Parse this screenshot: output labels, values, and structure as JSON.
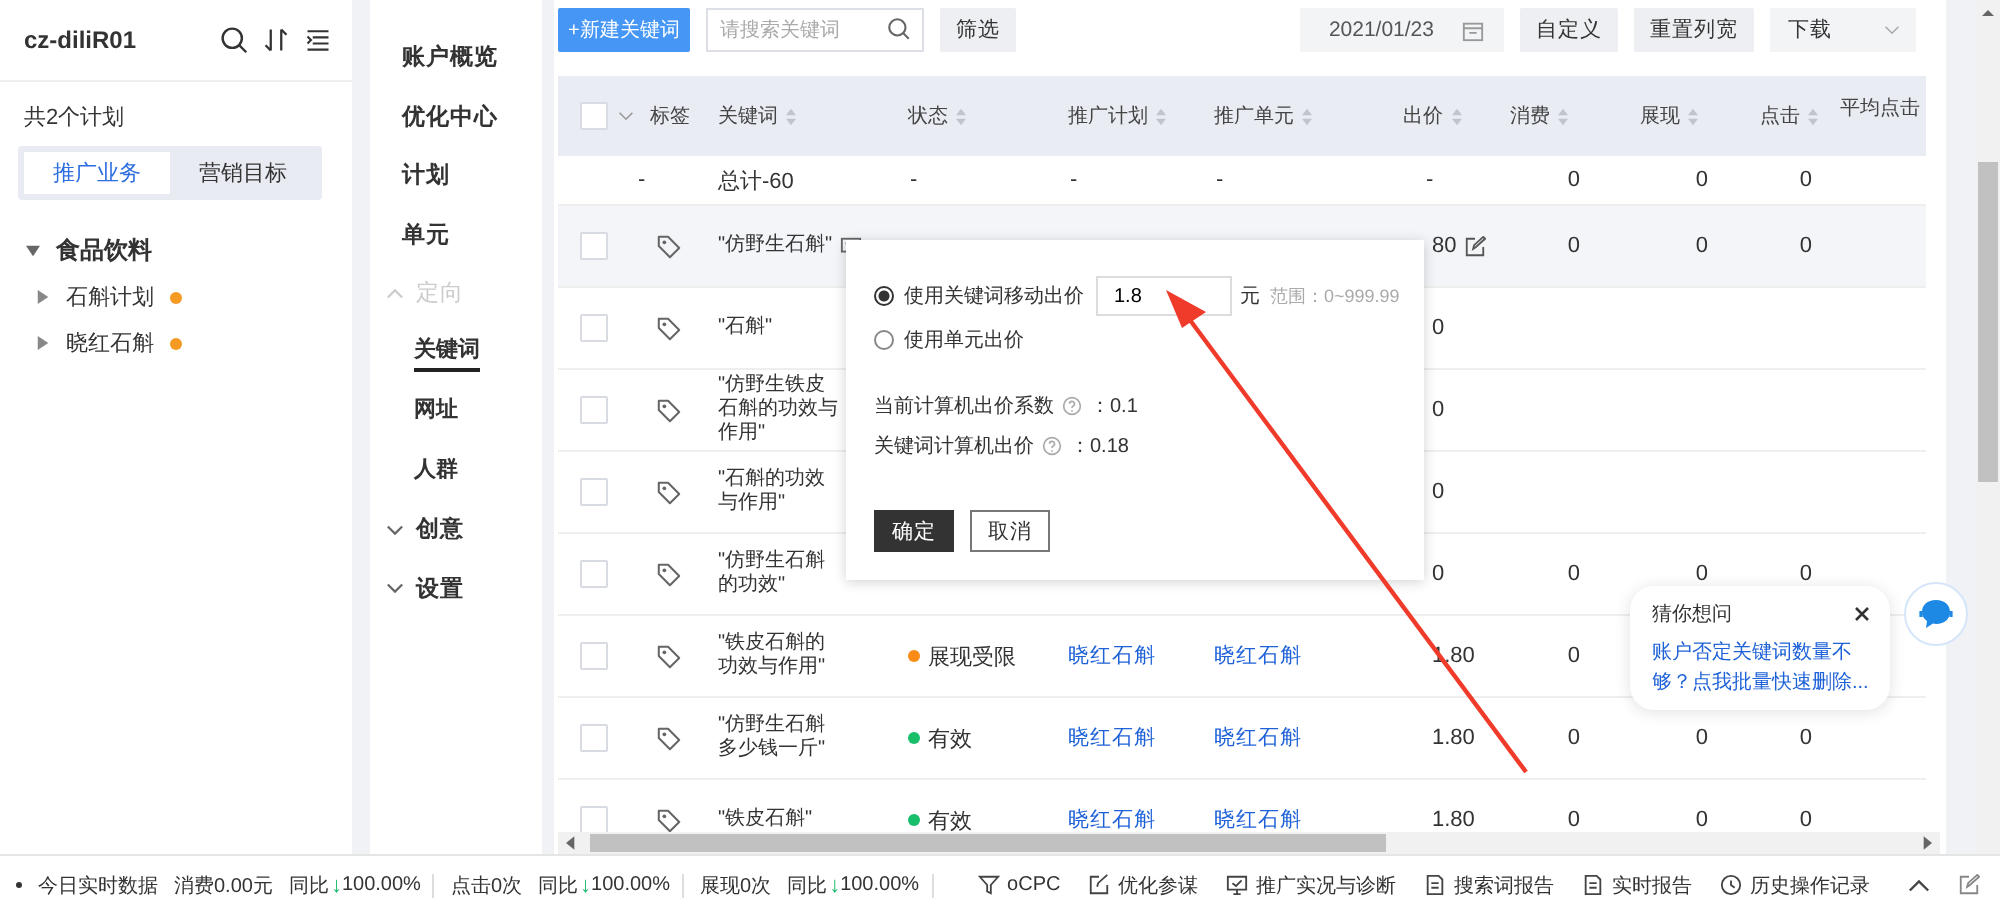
{
  "account": {
    "name": "cz-diliR01",
    "plan_count": "共2个计划"
  },
  "tabs": [
    {
      "label": "推广业务",
      "selected": true
    },
    {
      "label": "营销目标",
      "selected": false
    }
  ],
  "tree": [
    {
      "label": "食品饮料",
      "expanded": true,
      "children": [
        {
          "label": "石斛计划",
          "expanded": false,
          "color": "#f59a23"
        },
        {
          "label": "晓红石斛",
          "expanded": false,
          "color": "#f59a23"
        }
      ]
    }
  ],
  "nav": [
    {
      "label": "账户概览",
      "kind": "link",
      "selected": false
    },
    {
      "label": "优化中心",
      "kind": "link",
      "selected": false
    },
    {
      "label": "计划",
      "kind": "link",
      "selected": false
    },
    {
      "label": "单元",
      "kind": "link",
      "selected": false
    },
    {
      "label": "定向",
      "kind": "group",
      "expanded": true,
      "children": [
        {
          "label": "关键词",
          "selected": true
        },
        {
          "label": "网址",
          "selected": false
        },
        {
          "label": "人群",
          "selected": false
        }
      ]
    },
    {
      "label": "创意",
      "kind": "group",
      "expanded": false
    },
    {
      "label": "设置",
      "kind": "group",
      "expanded": false
    }
  ],
  "toolbar": {
    "new_button": "+新建关键词",
    "search": {
      "placeholder": "请搜索关键词"
    },
    "filter_button": "筛选",
    "date": "2021/01/23",
    "buttons": [
      "自定义",
      "重置列宽"
    ],
    "download": "下载"
  },
  "table": {
    "header_checkbox": {
      "checked": false
    },
    "columns": [
      {
        "label": "标签",
        "sortable": false
      },
      {
        "label": "关键词",
        "sortable": true
      },
      {
        "label": "状态",
        "sortable": true
      },
      {
        "label": "推广计划",
        "sortable": true
      },
      {
        "label": "推广单元",
        "sortable": true
      },
      {
        "label": "出价",
        "sortable": true
      },
      {
        "label": "消费",
        "sortable": true
      },
      {
        "label": "展现",
        "sortable": true
      },
      {
        "label": "点击",
        "sortable": true
      },
      {
        "label": "平均点击",
        "sortable": false
      }
    ],
    "total_row": [
      "-",
      "总计-60",
      "-",
      "-",
      "-",
      "-",
      "0",
      "0",
      "0"
    ],
    "rows": [
      {
        "selected": false,
        "keyword": "\"仿野生石斛\"",
        "note_icon": true,
        "price": "80",
        "edit_icon": true,
        "cost": "0",
        "impressions": "0",
        "clicks": "0"
      },
      {
        "selected": false,
        "keyword": "\"石斛\"",
        "note_icon": false,
        "price": "0",
        "edit_icon": false
      },
      {
        "selected": false,
        "keyword": "\"仿野生铁皮石斛的功效与作用\"",
        "note_icon": false,
        "price": "0",
        "edit_icon": false
      },
      {
        "selected": false,
        "keyword": "\"石斛的功效与作用\"",
        "note_icon": false,
        "price": "0",
        "edit_icon": false
      },
      {
        "selected": false,
        "keyword": "\"仿野生石斛的功效\"",
        "note_icon": false,
        "price": "0",
        "edit_icon": false,
        "cost": "0",
        "impressions": "0",
        "clicks": "0"
      },
      {
        "selected": false,
        "keyword": "\"铁皮石斛的功效与作用\"",
        "note_icon": false,
        "status": {
          "label": "展现受限",
          "color": "#fa8c16"
        },
        "plan": "晓红石斛",
        "unit": "晓红石斛",
        "price": "1.80",
        "edit_icon": false,
        "cost": "0"
      },
      {
        "selected": false,
        "keyword": "\"仿野生石斛多少钱一斤\"",
        "note_icon": false,
        "status": {
          "label": "有效",
          "color": "#19be6b"
        },
        "plan": "晓红石斛",
        "unit": "晓红石斛",
        "price": "1.80",
        "edit_icon": false,
        "cost": "0",
        "impressions": "0",
        "clicks": "0"
      },
      {
        "selected": false,
        "keyword": "\"铁皮石斛\"",
        "note_icon": false,
        "status": {
          "label": "有效",
          "color": "#19be6b"
        },
        "plan": "晓红石斛",
        "unit": "晓红石斛",
        "price": "1.80",
        "edit_icon": false,
        "cost": "0",
        "impressions": "0",
        "clicks": "0"
      }
    ]
  },
  "popover": {
    "options": [
      {
        "label": "使用关键词移动出价",
        "selected": true,
        "value": "1.8",
        "unit": "元",
        "range": "范围：0~999.99"
      },
      {
        "label": "使用单元出价",
        "selected": false
      }
    ],
    "stats": [
      {
        "label": "当前计算机出价系数",
        "value": "：0.1"
      },
      {
        "label": "关键词计算机出价",
        "value": "：0.18"
      }
    ],
    "confirm": "确定",
    "cancel": "取消"
  },
  "help_bubble": {
    "title": "猜你想问",
    "link": "账户否定关键词数量不够？点我批量快速删除..."
  },
  "status_bar": {
    "title": "今日实时数据",
    "metrics": [
      {
        "label": "消费0.00元",
        "compare": "同比",
        "arrow": "↓",
        "change": "100.00%"
      },
      {
        "label": "点击0次",
        "compare": "同比",
        "arrow": "↓",
        "change": "100.00%"
      },
      {
        "label": "展现0次",
        "compare": "同比",
        "arrow": "↓",
        "change": "100.00%"
      }
    ],
    "tools": [
      "oCPC",
      "优化参谋",
      "推广实况与诊断",
      "搜索词报告",
      "实时报告",
      "历史操作记录"
    ]
  }
}
